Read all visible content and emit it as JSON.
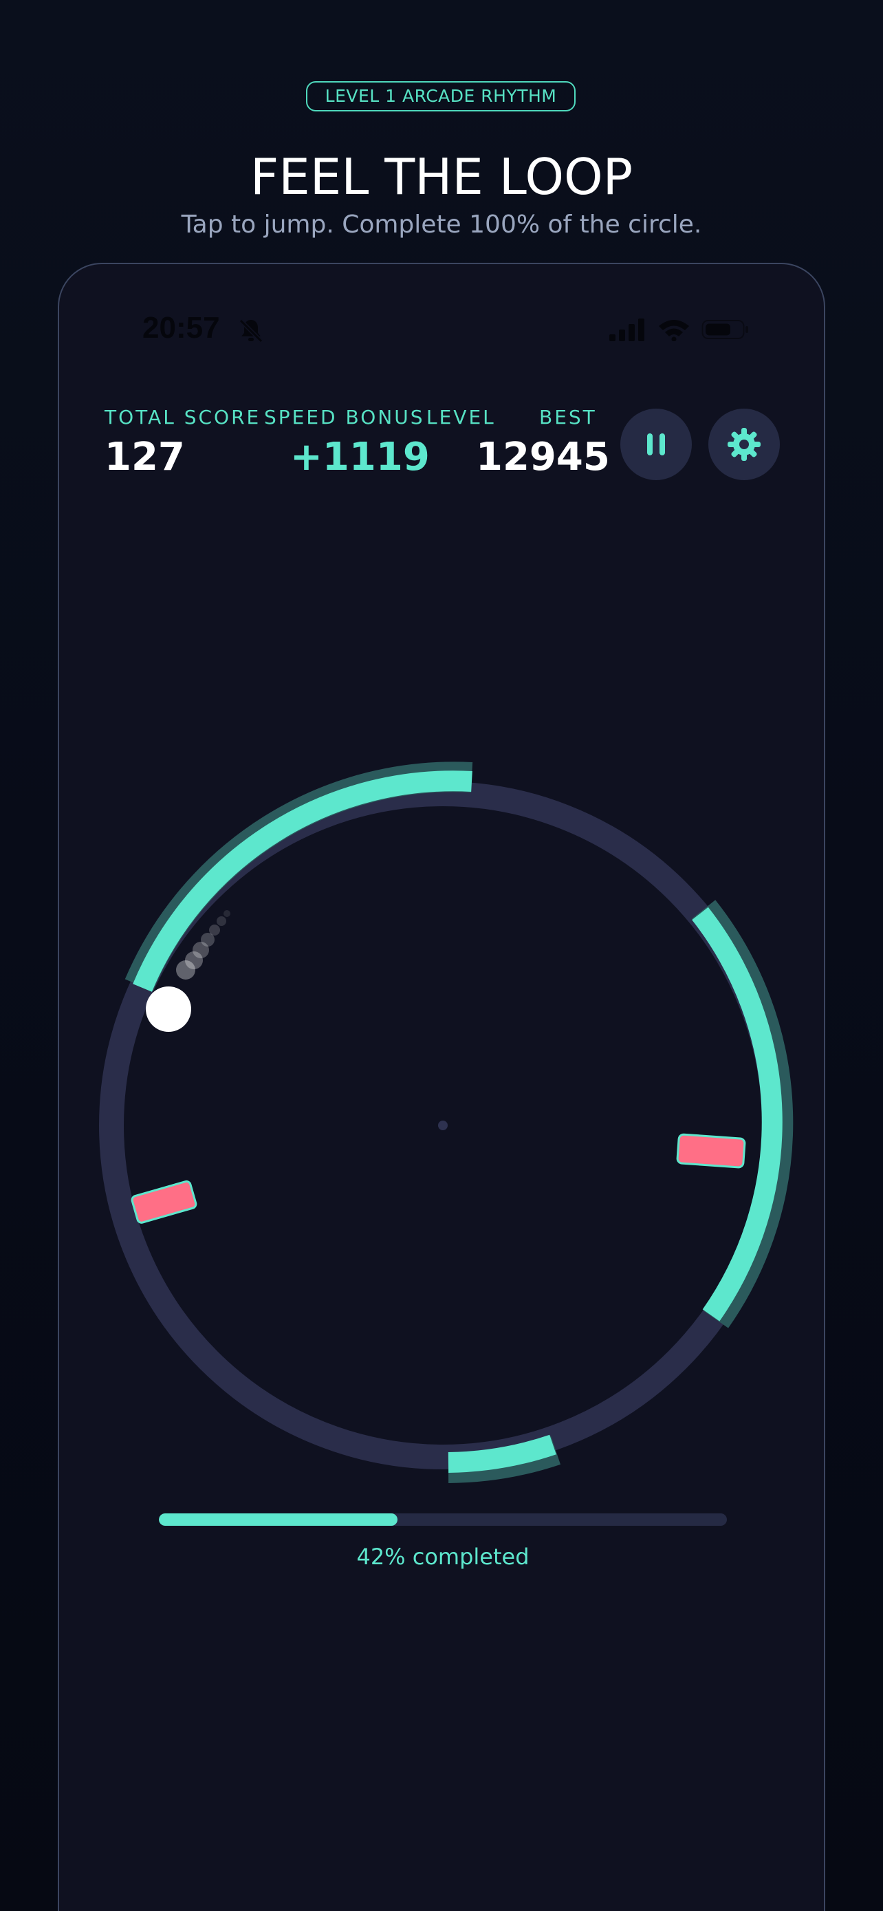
{
  "header": {
    "badge": "LEVEL 1 ARCADE RHYTHM",
    "title": "FEEL THE LOOP",
    "subtitle": "Tap to jump. Complete 100% of the circle."
  },
  "status_bar": {
    "time": "20:57",
    "icons": [
      "bell-muted-icon",
      "cellular-signal-icon",
      "wifi-icon",
      "battery-icon"
    ]
  },
  "hud": {
    "total_score_label": "TOTAL SCORE",
    "total_score_value": "127",
    "speed_bonus_label": "SPEED BONUS",
    "speed_bonus_value": "+1119",
    "level_label": "LEVEL",
    "best_label": "BEST",
    "best_value": "12945"
  },
  "controls": {
    "pause_icon": "pause-icon",
    "settings_icon": "gear-icon"
  },
  "progress": {
    "fraction": 0.42,
    "label": "42% completed"
  },
  "colors": {
    "accent": "#5de7cd",
    "track": "#2a2d4a",
    "obstacle": "#ff6f86",
    "background": "#0f1120"
  }
}
